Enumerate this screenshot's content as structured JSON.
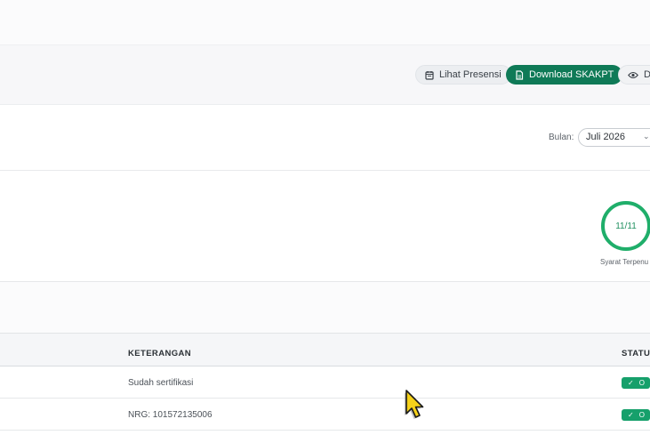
{
  "toolbar": {
    "presensi_label": "Lihat Presensi",
    "download_label": "Download SKAKPT",
    "detail_label": "De"
  },
  "filter": {
    "label": "Bulan:",
    "selected": "Juli 2026"
  },
  "summary": {
    "fulfilled": 11,
    "total": 11,
    "ratio_text": "11/11",
    "caption": "Syarat Terpenu"
  },
  "table": {
    "columns": [
      "KETERANGAN",
      "STATU"
    ],
    "rows": [
      {
        "keterangan": "Sudah sertifikasi",
        "status": "O"
      },
      {
        "keterangan": "NRG: 101572135006",
        "status": "O"
      }
    ]
  },
  "colors": {
    "accent": "#0f7a57",
    "success": "#16a06b",
    "ring": "#1fae6a"
  },
  "icons": {
    "presensi": "calendar-icon",
    "download": "document-icon",
    "detail": "eye-icon",
    "select": "chevron-down-icon",
    "status_check": "check-icon"
  }
}
